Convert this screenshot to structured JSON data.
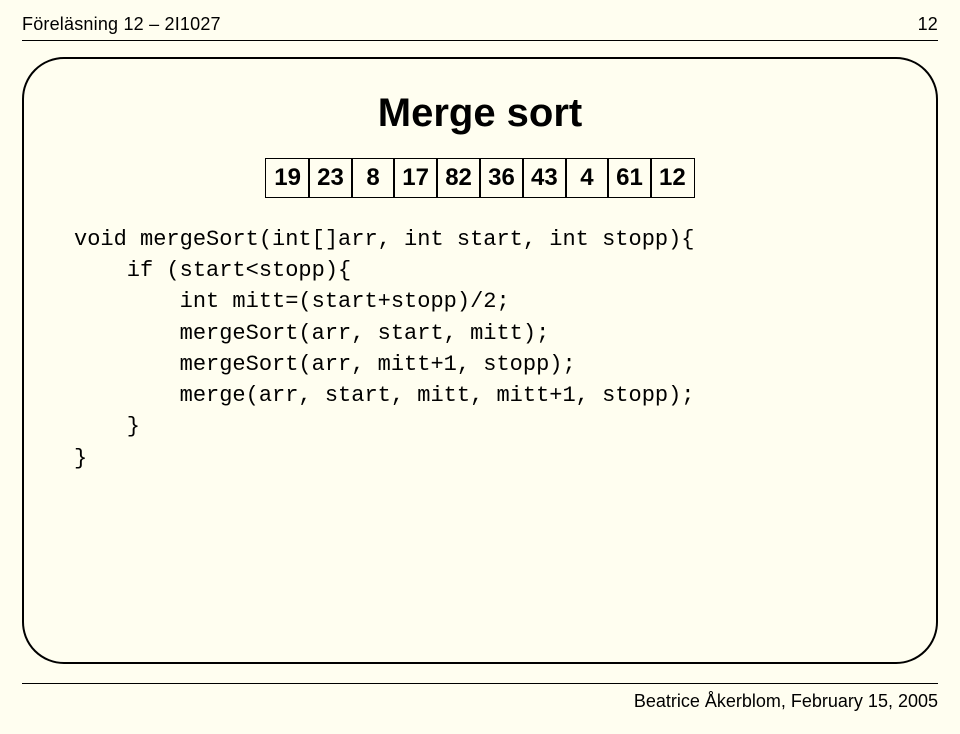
{
  "header": {
    "left": "Föreläsning 12 – 2I1027",
    "right": "12"
  },
  "title": "Merge sort",
  "boxes": [
    "19",
    "23",
    "8",
    "17",
    "82",
    "36",
    "43",
    "4",
    "61",
    "12"
  ],
  "code": {
    "l1": "void mergeSort(int[]arr, int start, int stopp){",
    "l2": "    if (start<stopp){",
    "l3": "        int mitt=(start+stopp)/2;",
    "l4": "        mergeSort(arr, start, mitt);",
    "l5": "        mergeSort(arr, mitt+1, stopp);",
    "l6": "        merge(arr, start, mitt, mitt+1, stopp);",
    "l7": "    }",
    "l8": "}"
  },
  "footer": "Beatrice Åkerblom, February 15, 2005"
}
